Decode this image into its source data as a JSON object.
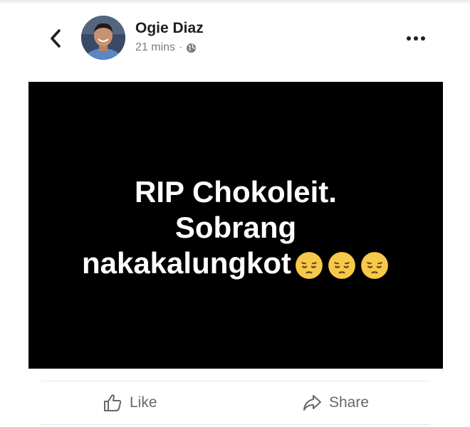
{
  "post": {
    "author": "Ogie Diaz",
    "time": "21 mins",
    "separator": "·",
    "content_lines": [
      "RIP  Chokoleit.",
      "Sobrang",
      "nakakalungkot"
    ],
    "emoji_count": 3,
    "emoji": "pensive-face"
  },
  "actions": {
    "like_label": "Like",
    "share_label": "Share"
  },
  "colors": {
    "image_background": "#000000",
    "post_text": "#ffffff",
    "action_text": "#65676b",
    "meta_text": "#7a7d82"
  }
}
